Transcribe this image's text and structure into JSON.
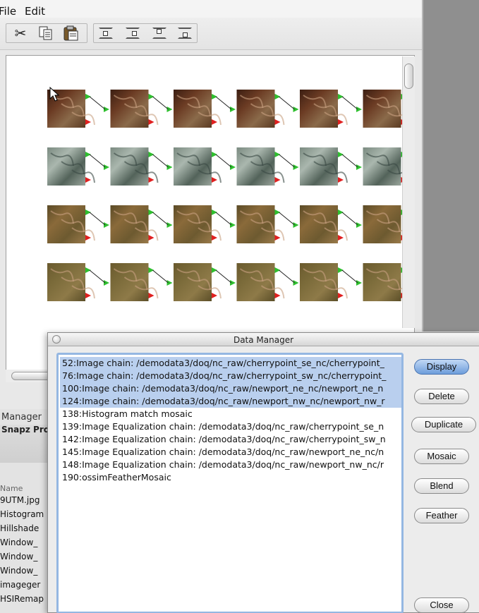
{
  "menubar": {
    "file_label": "File",
    "edit_label": "Edit"
  },
  "toolbar": {
    "items": [
      "cut-icon",
      "copy-icon",
      "paste-icon",
      "align-bottom-icon",
      "align-right-icon",
      "align-top-icon",
      "align-left-icon"
    ]
  },
  "canvas": {
    "rows": 4,
    "columns": 6
  },
  "left_panel": {
    "title": "Manager",
    "subtitle": "Snapz Pro",
    "column_header": "Name",
    "items": [
      "9UTM.jpg",
      "Histogram",
      "Hillshade",
      "Window_",
      "Window_",
      "Window_",
      "imageger",
      "HSIRemap"
    ]
  },
  "data_manager": {
    "title": "Data Manager",
    "rows": [
      "52:Image chain: /demodata3/doq/nc_raw/cherrypoint_se_nc/cherrypoint_",
      "76:Image chain: /demodata3/doq/nc_raw/cherrypoint_sw_nc/cherrypoint_",
      "100:Image chain: /demodata3/doq/nc_raw/newport_ne_nc/newport_ne_n",
      "124:Image chain: /demodata3/doq/nc_raw/newport_nw_nc/newport_nw_r",
      "138:Histogram match mosaic",
      "139:Image Equalization chain: /demodata3/doq/nc_raw/cherrypoint_se_n",
      "142:Image Equalization chain: /demodata3/doq/nc_raw/cherrypoint_sw_n",
      "145:Image Equalization chain: /demodata3/doq/nc_raw/newport_ne_nc/n",
      "148:Image Equalization chain: /demodata3/doq/nc_raw/newport_nw_nc/r",
      "190:ossimFeatherMosaic"
    ],
    "selected_rows": [
      0,
      1,
      2,
      3
    ],
    "buttons": {
      "display": "Display",
      "delete": "Delete",
      "duplicate": "Duplicate",
      "mosaic": "Mosaic",
      "blend": "Blend",
      "feather": "Feather",
      "close": "Close"
    }
  },
  "colors": {
    "selection": "#b9cfee",
    "default_button": "#6d9ddb",
    "connector_green": "#2fbf2f",
    "connector_red": "#e02020"
  }
}
